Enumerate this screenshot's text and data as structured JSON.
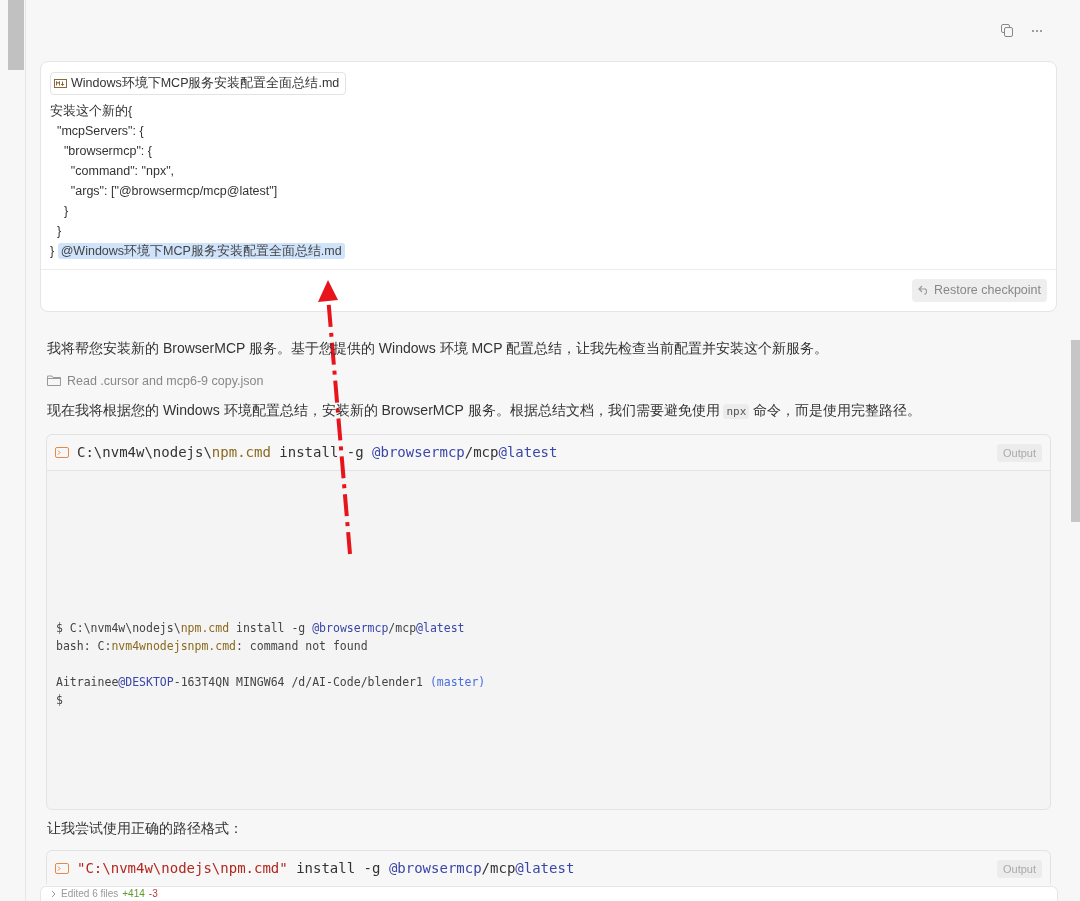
{
  "user_message": {
    "attachment": "Windows环境下MCP服务安装配置全面总结.md",
    "lines": [
      "安装这个新的{",
      "  \"mcpServers\": {",
      "    \"browsermcp\": {",
      "      \"command\": \"npx\",",
      "      \"args\": [\"@browsermcp/mcp@latest\"]",
      "    }",
      "  }"
    ],
    "last_line": "}",
    "mention": "@Windows环境下MCP服务安装配置全面总结.md",
    "restore_button": "Restore checkpoint"
  },
  "reply": [
    {
      "kind": "paragraph",
      "text": "我将帮您安装新的 BrowserMCP 服务。基于您提供的 Windows 环境 MCP 配置总结，让我先检查当前配置并安装这个新服务。"
    },
    {
      "kind": "file_read",
      "text": "Read .cursor and mcp6-9 copy.json"
    },
    {
      "kind": "paragraph",
      "parts": [
        {
          "text": "现在我将根据您的 Windows 环境配置总结，安装新的 BrowserMCP 服务。根据总结文档，我们需要避免使用 ",
          "code": false
        },
        {
          "text": "npx",
          "code": true
        },
        {
          "text": " 命令，而是使用完整路径。",
          "code": false
        }
      ]
    },
    {
      "kind": "terminal",
      "badge": "Output",
      "command": [
        {
          "kind": "plain",
          "text": "C:\\nvm4w\\nodejs\\"
        },
        {
          "kind": "path",
          "text": "npm.cmd"
        },
        {
          "kind": "plain",
          "text": " install -g "
        },
        {
          "kind": "at",
          "text": "@browsermcp"
        },
        {
          "kind": "plain",
          "text": "/mcp"
        },
        {
          "kind": "at",
          "text": "@latest"
        }
      ],
      "output_blocks": [
        {
          "lines": [
            {
              "tokens": [
                {
                  "kind": "plain",
                  "text": "$ C:\\nvm4w\\nodejs\\"
                },
                {
                  "kind": "path",
                  "text": "npm.cmd"
                },
                {
                  "kind": "plain",
                  "text": " install -g "
                },
                {
                  "kind": "at",
                  "text": "@browsermcp"
                },
                {
                  "kind": "plain",
                  "text": "/mcp"
                },
                {
                  "kind": "at",
                  "text": "@latest"
                }
              ]
            },
            {
              "tokens": [
                {
                  "kind": "plain",
                  "text": "bash: C:"
                },
                {
                  "kind": "path",
                  "text": "nvm4wnodejsnpm.cmd"
                },
                {
                  "kind": "plain",
                  "text": ": command not found"
                }
              ]
            }
          ]
        },
        {
          "lines": [
            {
              "tokens": [
                {
                  "kind": "plain",
                  "text": "Aitrainee"
                },
                {
                  "kind": "at",
                  "text": "@DESKTOP"
                },
                {
                  "kind": "plain",
                  "text": "-163T4QN MINGW64 /d/AI-Code/blender1 "
                },
                {
                  "kind": "paren",
                  "text": "(master)"
                }
              ]
            },
            {
              "tokens": [
                {
                  "kind": "plain",
                  "text": "$"
                }
              ]
            }
          ]
        }
      ]
    },
    {
      "kind": "paragraph",
      "text": "让我尝试使用正确的路径格式："
    },
    {
      "kind": "terminal",
      "badge": "Output",
      "command": [
        {
          "kind": "string",
          "text": "\"C:\\nvm4w\\nodejs\\npm.cmd\""
        },
        {
          "kind": "plain",
          "text": " install -g "
        },
        {
          "kind": "at",
          "text": "@browsermcp"
        },
        {
          "kind": "plain",
          "text": "/mcp"
        },
        {
          "kind": "at",
          "text": "@latest"
        }
      ]
    }
  ],
  "edited_bar": {
    "label": "Edited 6 files",
    "added": "+414",
    "removed": "-3"
  }
}
